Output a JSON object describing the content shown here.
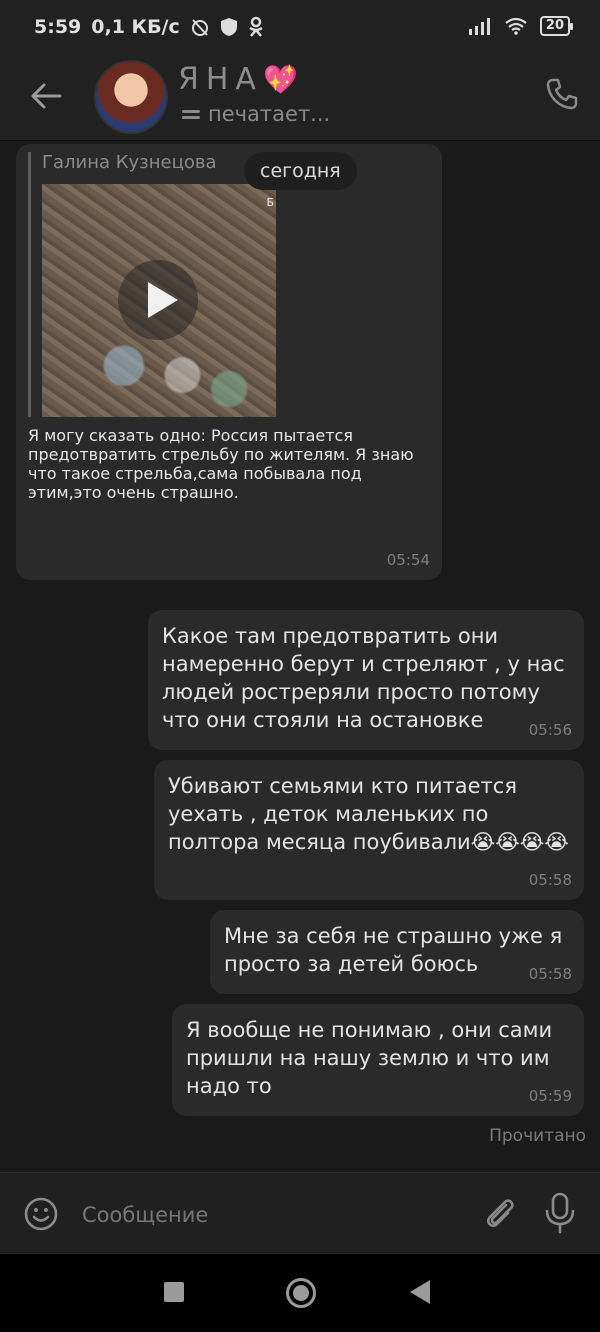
{
  "status_bar": {
    "time": "5:59",
    "net_speed": "0,1 КБ/с",
    "battery": "20"
  },
  "header": {
    "contact_name": "ЯНА",
    "heart_emoji": "💖",
    "status": "печатает..."
  },
  "date_separator": "сегодня",
  "incoming": {
    "quoted_author": "Галина Кузнецова",
    "video_label": "Б",
    "text": "Я могу сказать одно: Россия пытается предотвратить стрельбу по жителям. Я знаю что такое стрельба,сама побывала под этим,это очень страшно.",
    "time": "05:54"
  },
  "outgoing": [
    {
      "text": "Какое там предотвратить они намеренно берут и стреляют , у нас людей ростреряли просто потому что они стояли на остановке",
      "time": "05:56"
    },
    {
      "text": "Убивают семьями кто питается уехать , деток маленьких по полтора месяца поубивали😭😭😭😭",
      "time": "05:58"
    },
    {
      "text": "Мне за себя не страшно уже я просто за детей боюсь",
      "time": "05:58"
    },
    {
      "text": "Я вообще не понимаю , они сами пришли на нашу землю и что им надо то",
      "time": "05:59"
    }
  ],
  "read_status": "Прочитано",
  "input": {
    "placeholder": "Сообщение"
  },
  "colors": {
    "background": "#1a1a1a",
    "bubble": "#2a2a2a",
    "heart": "#ff5fa3"
  },
  "icons": [
    "back-arrow-icon",
    "phone-icon",
    "emoji-icon",
    "paperclip-icon",
    "microphone-icon",
    "play-icon"
  ]
}
